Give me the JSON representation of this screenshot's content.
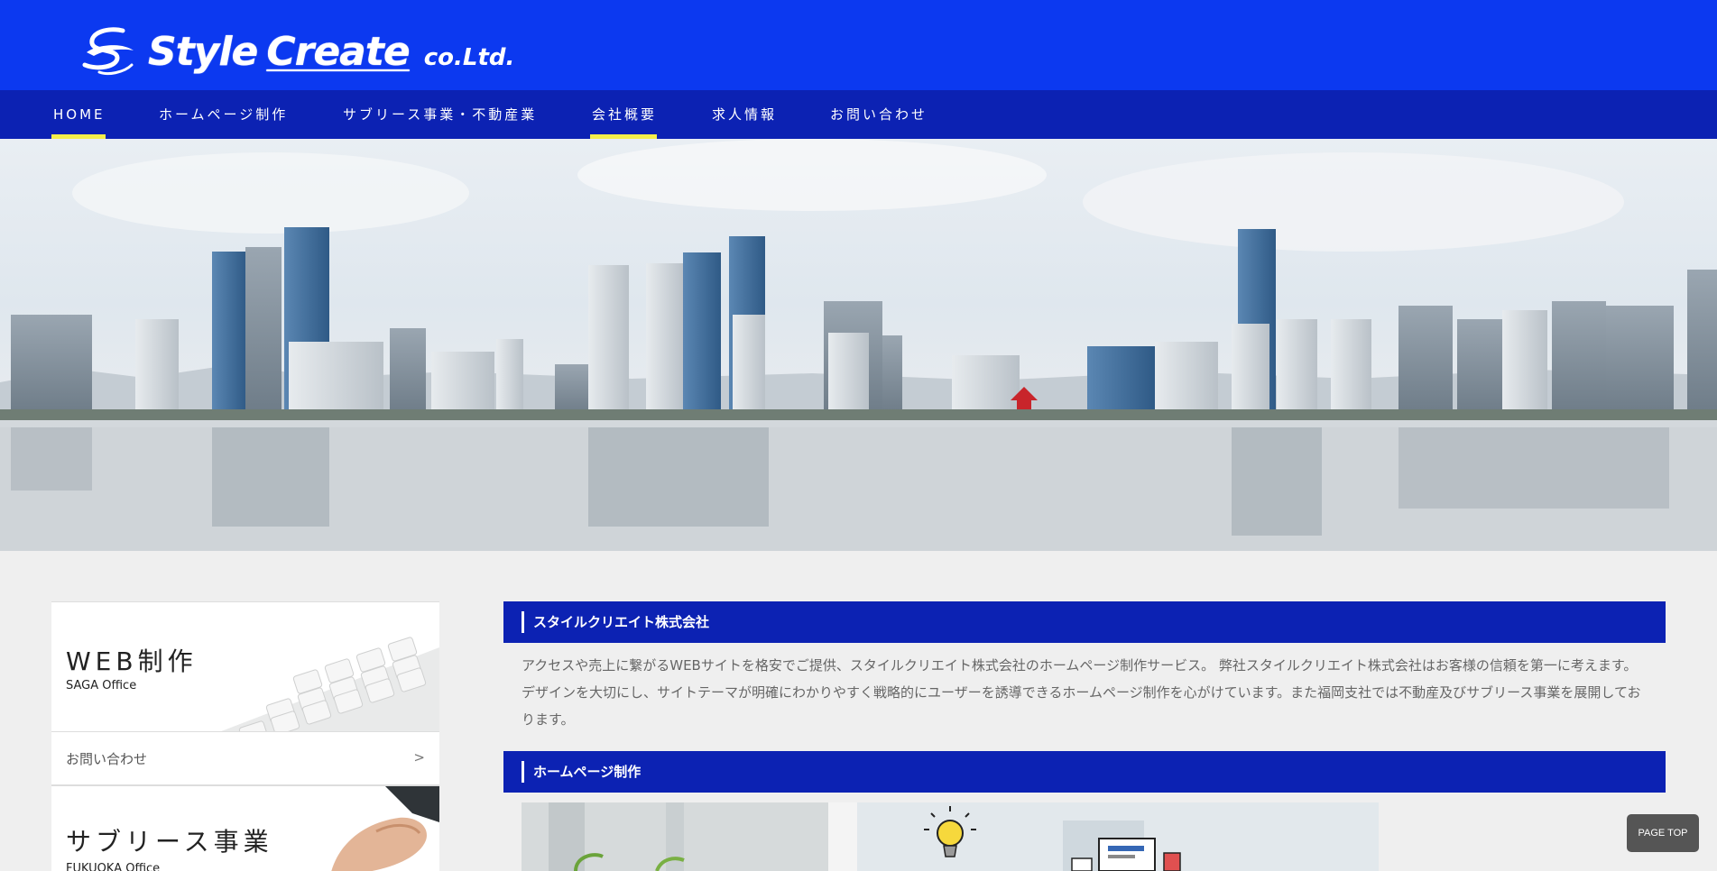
{
  "header": {
    "logo_main": "Style",
    "logo_create": "Create",
    "logo_co": "co.Ltd.",
    "logo_icon": "swoosh-s-logo-icon"
  },
  "nav": {
    "items": [
      {
        "label": "HOME",
        "active": true
      },
      {
        "label": "ホームページ制作",
        "active": false
      },
      {
        "label": "サブリース事業・不動産業",
        "active": false
      },
      {
        "label": "会社概要",
        "active": true
      },
      {
        "label": "求人情報",
        "active": false
      },
      {
        "label": "お問い合わせ",
        "active": false
      }
    ]
  },
  "sidebar": {
    "web_card": {
      "title": "WEB制作",
      "subtitle": "SAGA Office"
    },
    "contact_link": {
      "label": "お問い合わせ",
      "arrow": ">"
    },
    "sublease_card": {
      "title": "サブリース事業",
      "subtitle": "FUKUOKA Office"
    }
  },
  "main": {
    "company_heading": "スタイルクリエイト株式会社",
    "intro_text": "アクセスや売上に繋がるWEBサイトを格安でご提供、スタイルクリエイト株式会社のホームページ制作サービス。 弊社スタイルクリエイト株式会社はお客様の信頼を第一に考えます。デザインを大切にし、サイトテーマが明確にわかりやすく戦略的にユーザーを誘導できるホームページ制作を心がけています。また福岡支社では不動産及びサブリース事業を展開しております。",
    "homepage_heading": "ホームページ制作"
  },
  "page_top": {
    "label": "PAGE TOP"
  },
  "colors": {
    "header_blue": "#0c39f0",
    "nav_blue": "#0c22b3",
    "active_underline": "#f5ef4a"
  }
}
